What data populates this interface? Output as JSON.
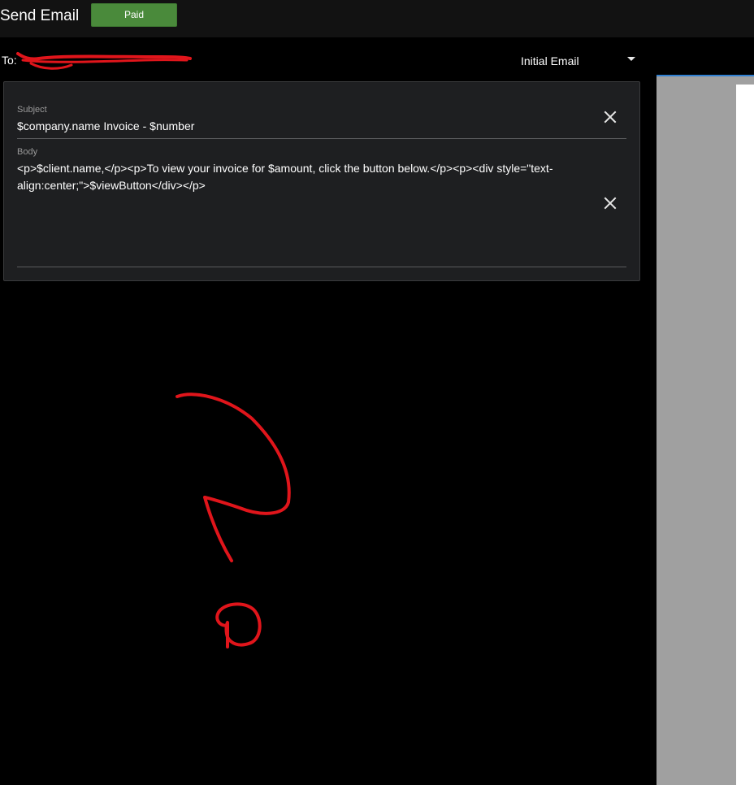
{
  "header": {
    "title": "Send Email",
    "status_badge": "Paid"
  },
  "recipient": {
    "to_label": "To:"
  },
  "template": {
    "selected": "Initial Email"
  },
  "form": {
    "subject": {
      "label": "Subject",
      "value": "$company.name Invoice - $number"
    },
    "body": {
      "label": "Body",
      "value": "<p>$client.name,</p><p>To view your invoice for $amount, click the button below.</p><p><div style=\"text-align:center;\">$viewButton</div></p>"
    }
  },
  "icons": {
    "clear": "close-icon",
    "dropdown": "chevron-down-icon"
  },
  "colors": {
    "badge": "#4a8a3b",
    "card": "#1e1f21",
    "accent": "#2f7fd1",
    "annotation": "#e0151b"
  }
}
